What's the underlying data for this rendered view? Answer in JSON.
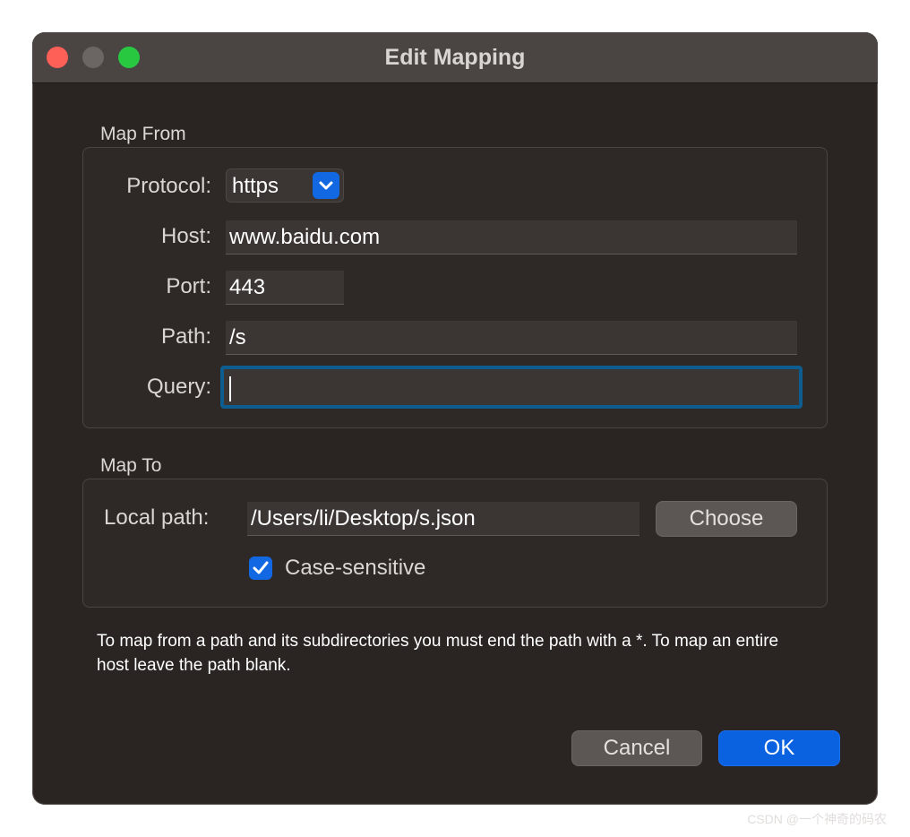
{
  "window": {
    "title": "Edit Mapping"
  },
  "map_from": {
    "label": "Map From",
    "protocol_label": "Protocol:",
    "protocol_value": "https",
    "host_label": "Host:",
    "host_value": "www.baidu.com",
    "port_label": "Port:",
    "port_value": "443",
    "path_label": "Path:",
    "path_value": "/s",
    "query_label": "Query:",
    "query_value": ""
  },
  "map_to": {
    "label": "Map To",
    "local_path_label": "Local path:",
    "local_path_value": "/Users/li/Desktop/s.json",
    "choose_label": "Choose",
    "case_sensitive_label": "Case-sensitive",
    "case_sensitive_checked": true
  },
  "help_text": "To map from a path and its subdirectories you must end the path with a *. To map an entire host leave the path blank.",
  "buttons": {
    "cancel": "Cancel",
    "ok": "OK"
  },
  "watermark": "CSDN @一个神奇的码农",
  "colors": {
    "accent": "#1268e3",
    "focus_ring": "#0e5d90",
    "window_bg": "#2a2523"
  },
  "icons": {
    "protocol_dropdown": "chevron-down-icon",
    "checkbox": "checkmark-icon"
  }
}
